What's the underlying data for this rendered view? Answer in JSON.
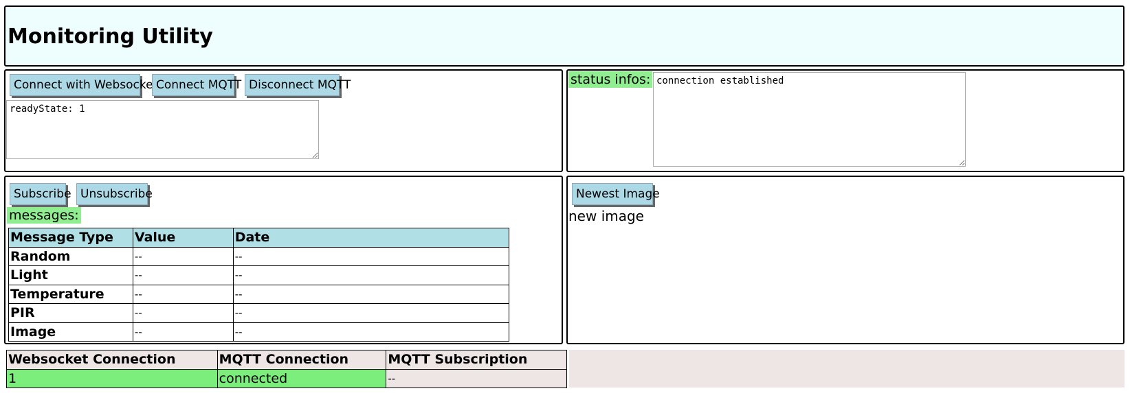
{
  "header": {
    "title": "Monitoring Utility"
  },
  "connect": {
    "ws_button": "Connect with Websocket",
    "mqtt_connect_button": "Connect MQTT",
    "mqtt_disconnect_button": "Disconnect MQTT",
    "log_text": "readyState: 1"
  },
  "status": {
    "label": "status infos:",
    "text": "connection established"
  },
  "subscribe": {
    "subscribe_button": "Subscribe",
    "unsubscribe_button": "Unsubscribe",
    "messages_label": "messages:",
    "table": {
      "headers": [
        "Message Type",
        "Value",
        "Date"
      ],
      "rows": [
        {
          "type": "Random",
          "value": "--",
          "date": "--"
        },
        {
          "type": "Light",
          "value": "--",
          "date": "--"
        },
        {
          "type": "Temperature",
          "value": "--",
          "date": "--"
        },
        {
          "type": "PIR",
          "value": "--",
          "date": "--"
        },
        {
          "type": "Image",
          "value": "--",
          "date": "--"
        }
      ]
    }
  },
  "image": {
    "newest_button": "Newest Image",
    "placeholder_text": "new image"
  },
  "connection_status": {
    "headers": [
      "Websocket Connection",
      "MQTT Connection",
      "MQTT Subscription"
    ],
    "values": [
      "1",
      "connected",
      "--"
    ]
  },
  "colors": {
    "header_bg": "#eefeff",
    "button_bg": "#add8e6",
    "label_green": "#90ee90",
    "table_header_bg": "#b0e0e6",
    "status_ok": "#7cee7c",
    "status_bg": "#eee5e5"
  }
}
